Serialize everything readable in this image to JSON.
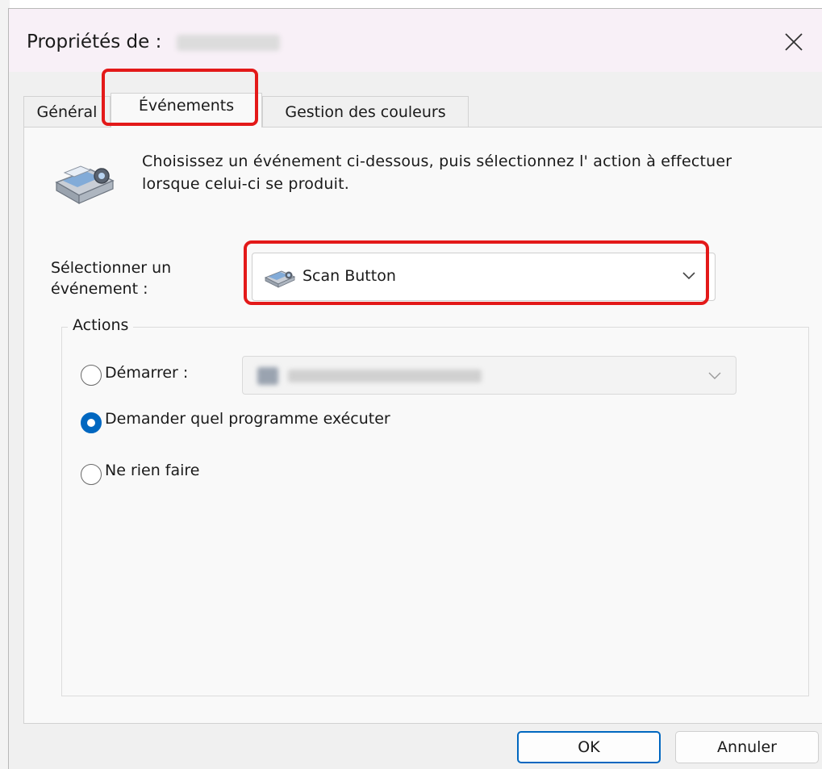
{
  "window": {
    "title": "Propriétés de :",
    "close_icon": "close-icon"
  },
  "tabs": [
    {
      "label": "Général",
      "active": false
    },
    {
      "label": "Événements",
      "active": true
    },
    {
      "label": "Gestion des couleurs",
      "active": false
    }
  ],
  "events_page": {
    "intro_text": "Choisissez un événement ci-dessous, puis sélectionnez l' action à effectuer lorsque celui-ci se produit.",
    "header_icon": "scanner-icon",
    "select_event_label": "Sélectionner un événement :",
    "selected_event": "Scan Button",
    "selected_event_icon": "scanner-icon",
    "actions": {
      "legend": "Actions",
      "start_label": "Démarrer :",
      "ask_label": "Demander quel programme exécuter",
      "nothing_label": "Ne rien faire",
      "selected": "ask"
    }
  },
  "buttons": {
    "ok": "OK",
    "cancel": "Annuler"
  },
  "colors": {
    "highlight": "#e31919",
    "accent": "#0067c0"
  }
}
